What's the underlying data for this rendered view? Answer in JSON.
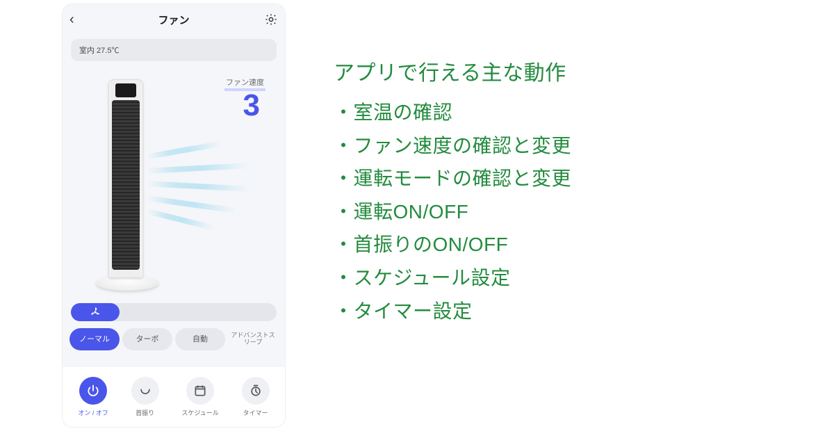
{
  "phone": {
    "header": {
      "title": "ファン"
    },
    "temp": {
      "label": "室内 27.5℃"
    },
    "speed": {
      "label": "ファン速度",
      "value": "3"
    },
    "modes": {
      "normal": "ノーマル",
      "turbo": "ターボ",
      "auto": "自動",
      "advsleep": "アドバンストスリープ"
    },
    "toolbar": {
      "power": "オン / オフ",
      "swing": "首振り",
      "schedule": "スケジュール",
      "timer": "タイマー"
    }
  },
  "features": {
    "heading": "アプリで行える主な動作",
    "items": [
      "室温の確認",
      "ファン速度の確認と変更",
      "運転モードの確認と変更",
      "運転ON/OFF",
      "首振りのON/OFF",
      "スケジュール設定",
      "タイマー設定"
    ]
  },
  "colors": {
    "accent": "#4a55ea",
    "feature_text": "#238b3e"
  }
}
